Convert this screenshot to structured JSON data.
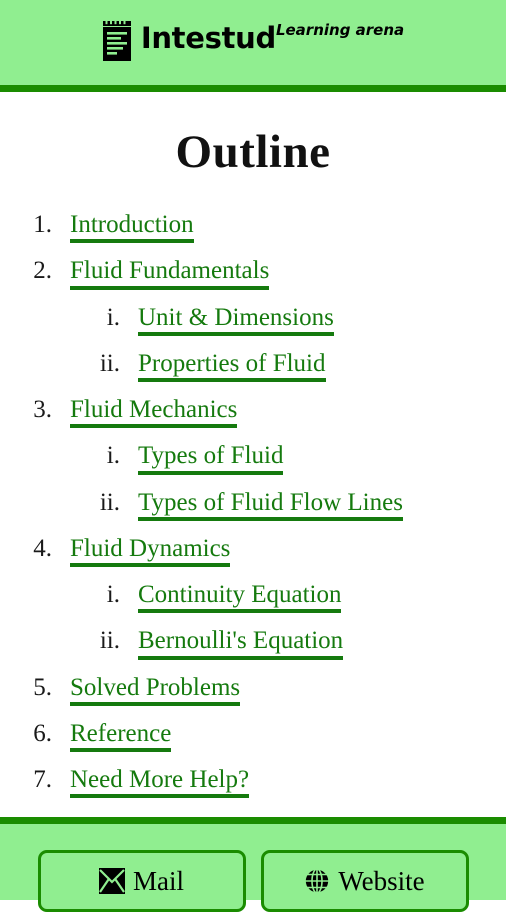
{
  "header": {
    "icon": "notepad-icon",
    "brand_name": "Intestud",
    "tagline": "Learning arena",
    "background_color": "#90ee90",
    "rule_color": "#1a8c00"
  },
  "main": {
    "title": "Outline",
    "link_color": "#157a0e",
    "items": [
      {
        "level": "top",
        "marker": "1.",
        "label": "Introduction"
      },
      {
        "level": "top",
        "marker": "2.",
        "label": "Fluid Fundamentals"
      },
      {
        "level": "sub",
        "marker": "i.",
        "label": "Unit & Dimensions"
      },
      {
        "level": "sub",
        "marker": "ii.",
        "label": "Properties of Fluid"
      },
      {
        "level": "top",
        "marker": "3.",
        "label": "Fluid Mechanics"
      },
      {
        "level": "sub",
        "marker": "i.",
        "label": "Types of Fluid"
      },
      {
        "level": "sub",
        "marker": "ii.",
        "label": "Types of Fluid Flow Lines"
      },
      {
        "level": "top",
        "marker": "4.",
        "label": "Fluid Dynamics"
      },
      {
        "level": "sub",
        "marker": "i.",
        "label": "Continuity Equation"
      },
      {
        "level": "sub",
        "marker": "ii.",
        "label": "Bernoulli's Equation"
      },
      {
        "level": "top",
        "marker": "5.",
        "label": "Solved Problems"
      },
      {
        "level": "top",
        "marker": "6.",
        "label": "Reference"
      },
      {
        "level": "top",
        "marker": "7.",
        "label": "Need More Help?"
      }
    ]
  },
  "footer": {
    "background_color": "#90ee90",
    "rule_color": "#1a8c00",
    "border_color": "#1a8c00",
    "buttons": [
      {
        "icon": "envelope-icon",
        "label": "Mail"
      },
      {
        "icon": "globe-icon",
        "label": "Website"
      }
    ]
  }
}
